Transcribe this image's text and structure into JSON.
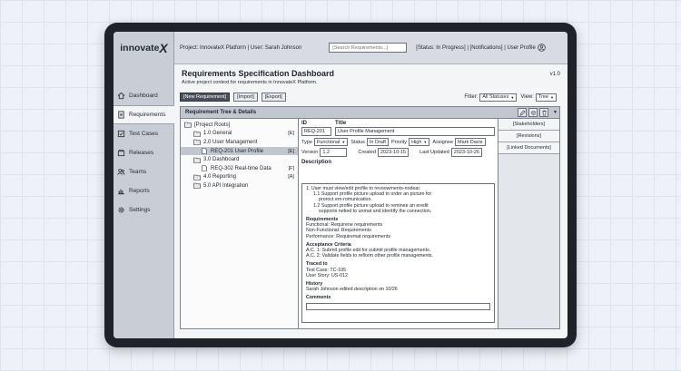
{
  "brand": {
    "name": "innovate",
    "mark": "X"
  },
  "topbar": {
    "context": "Project: InnovateX Platform  |  User: Sarah Johnson",
    "search_placeholder": "[Search Requirements...]",
    "status": "[Status: In Progress] | [Notifications] | User Profile"
  },
  "nav": [
    {
      "label": "Dashboard",
      "icon": "home-icon"
    },
    {
      "label": "Requirements",
      "icon": "document-icon",
      "active": true
    },
    {
      "label": "Test Cases",
      "icon": "checklist-icon"
    },
    {
      "label": "Releases",
      "icon": "box-icon"
    },
    {
      "label": "Teams",
      "icon": "people-icon"
    },
    {
      "label": "Reports",
      "icon": "chart-icon"
    },
    {
      "label": "Settings",
      "icon": "gear-icon"
    }
  ],
  "header": {
    "title": "Requirements Specification Dashboard",
    "subtitle": "Active project context for requirements in InnovateX Platform.",
    "version": "v1.0"
  },
  "toolbar": {
    "new": "[New Requirement]",
    "import": "[Import]",
    "export": "[Export]",
    "filter_label": "Filter:",
    "filter_value": "All Statuses",
    "view_label": "View:",
    "view_value": "Tree"
  },
  "panel": {
    "title": "Requirement Tree & Details"
  },
  "tree": [
    {
      "label": "[Project Roots]",
      "indent": 0,
      "icon": "folder",
      "badge": ""
    },
    {
      "label": "1.0 General",
      "indent": 1,
      "icon": "folder",
      "badge": "[E]"
    },
    {
      "label": "2.0 User Management",
      "indent": 1,
      "icon": "folder",
      "badge": ""
    },
    {
      "label": "REQ-201 User Profile",
      "indent": 2,
      "icon": "file",
      "badge": "[E]",
      "selected": true
    },
    {
      "label": "3.0 Dashboard",
      "indent": 1,
      "icon": "folder",
      "badge": ""
    },
    {
      "label": "REQ-302 Real-time Data",
      "indent": 2,
      "icon": "file",
      "badge": "[F]"
    },
    {
      "label": "4.0 Reporting",
      "indent": 1,
      "icon": "folder",
      "badge": "[A]"
    },
    {
      "label": "5.0 API Integration",
      "indent": 1,
      "icon": "folder",
      "badge": ""
    }
  ],
  "details": {
    "id_label": "ID",
    "title_label": "Title",
    "id": "REQ-201",
    "title": "User Profile Management",
    "type_label": "Type",
    "type": "Functional",
    "status_label": "Status",
    "status": "In Draft",
    "priority_label": "Priority",
    "priority": "High",
    "assignee_label": "Assignee",
    "assignee": "Mark Davis",
    "version_label": "Version",
    "version": "1.2",
    "created_label": "Created",
    "created": "2023-10-15",
    "updated_label": "Last Updated",
    "updated": "2023-10-26",
    "description_label": "Description",
    "desc_lines": [
      "1. User must view/edit profile to revoowments-nodear.",
      "1.1 Support profile picture upload to order an picture for",
      "proroct em-romunication.",
      "1.2 Support profile picture upload to reminee an eredit",
      "supports netied to unmat and identify the connection."
    ],
    "req_head": "Requirements",
    "req_lines": [
      "Functional: Requirene requirements",
      "Non-Functional: Requirements",
      "Performance: Requiremat requirements"
    ],
    "ac_head": "Acceptance Criteria",
    "ac_lines": [
      "A.C. 1: Submit profile edit for submit profile managements.",
      "A.C. 2: Validate fields to reflorm other profile managements."
    ],
    "trace_head": "Traced to",
    "trace_lines": [
      "Test Case: TC-105",
      "User Story: US-012"
    ],
    "history_head": "History",
    "history_lines": [
      "Sarah Johnson edited description on 10/26"
    ],
    "comments_head": "Comments"
  },
  "side_tabs": [
    "[Stakeholders]",
    "[Revisions]",
    "[Linked Documents]"
  ]
}
